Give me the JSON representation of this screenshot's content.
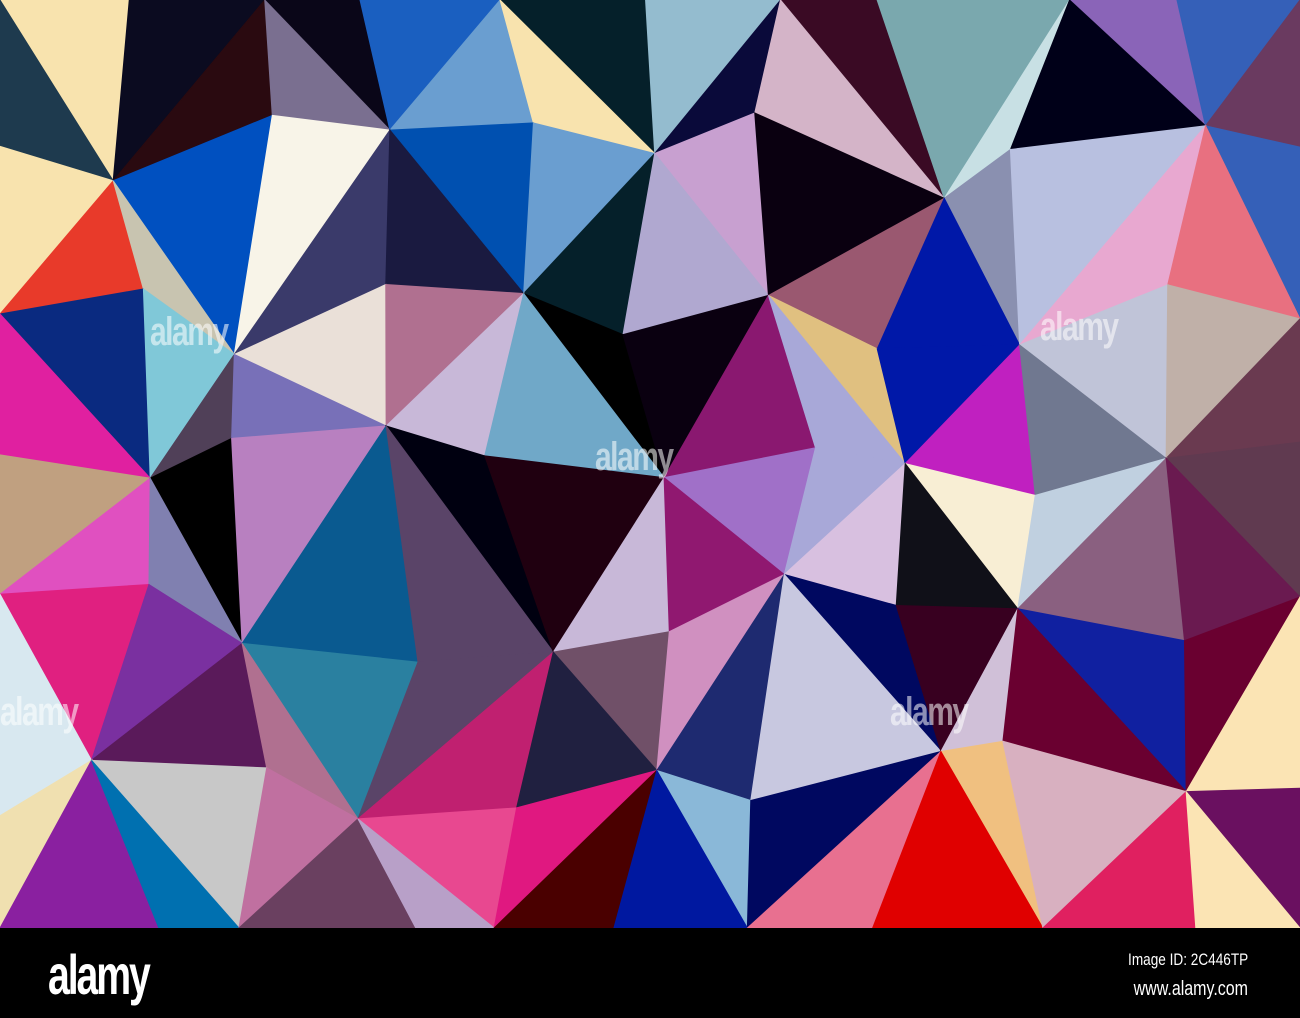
{
  "watermark": {
    "text": "alamy"
  },
  "footer": {
    "logo": "alamy",
    "image_id": "Image ID: 2C446TP",
    "website": "www.alamy.com"
  },
  "palette_rows": [
    [
      "#f8e3ae",
      "#1e3a4e",
      "#0b0b20",
      "#2a0a10",
      "#0a0618",
      "#7a6f90",
      "#1a5fc0",
      "#6a9ed0",
      "#05202a",
      "#f8e3ae",
      "#94bccf",
      "#0a0a3a",
      "#3a0a24",
      "#d4b4c8",
      "#7aa8ae",
      "#c8e0e4",
      "#8a64b8",
      "#000018",
      "#3560b8",
      "#6a3a60"
    ],
    [
      "#f8e3ae",
      "#e83a2a",
      "#0050c0",
      "#c8c4b0",
      "#f8f4e8",
      "#3a3a6a",
      "#0050b0",
      "#1a1a40",
      "#6a9ed0",
      "#05202a",
      "#c8a0d0",
      "#b0a8d0",
      "#0a0010",
      "#9a5870",
      "#8a90b0",
      "#0018a8",
      "#b8c0e0",
      "#e8a8d0",
      "#3560b8",
      "#e87080"
    ],
    [
      "#0a2a80",
      "#e020a0",
      "#80c8d8",
      "#504058",
      "#eae0d8",
      "#7870b8",
      "#b07090",
      "#c8b8d8",
      "#000000",
      "#70a8c8",
      "#0a0010",
      "#8a1870",
      "#e0c080",
      "#a8a8d8",
      "#0018a8",
      "#c020c0",
      "#c0c4d8",
      "#707890",
      "#c0b0a8",
      "#6a3a50"
    ],
    [
      "#c0a080",
      "#e050c0",
      "#000000",
      "#8080b0",
      "#b880c0",
      "#0a5a90",
      "#000010",
      "#5a4468",
      "#200010",
      "#c8b8d8",
      "#a070c8",
      "#901870",
      "#a8a8d8",
      "#d8c0e0",
      "#f8eed4",
      "#101018",
      "#c0d0e0",
      "#8a6080",
      "#603a50",
      "#6a1a50"
    ],
    [
      "#e02080",
      "#d8e8f0",
      "#7a30a0",
      "#5a1a5a",
      "#2a80a0",
      "#b07090",
      "#5a4468",
      "#c02070",
      "#705068",
      "#202040",
      "#d090c0",
      "#1e2a70",
      "#000860",
      "#c8c8e0",
      "#380020",
      "#d0c0d8",
      "#1020a0",
      "#6a0030",
      "#6a0030",
      "#fbe4b4"
    ],
    [
      "#f0e0b0",
      "#8a20a0",
      "#c8c8c8",
      "#0070b0",
      "#c070a0",
      "#6a4060",
      "#e84890",
      "#b8a0c8",
      "#e01880",
      "#4a0000",
      "#8ab8d8",
      "#0018a0",
      "#000860",
      "#e87090",
      "#f0c080",
      "#e00000",
      "#d8b0c0",
      "#e02060",
      "#6a1060",
      "#fbe4b4"
    ]
  ]
}
